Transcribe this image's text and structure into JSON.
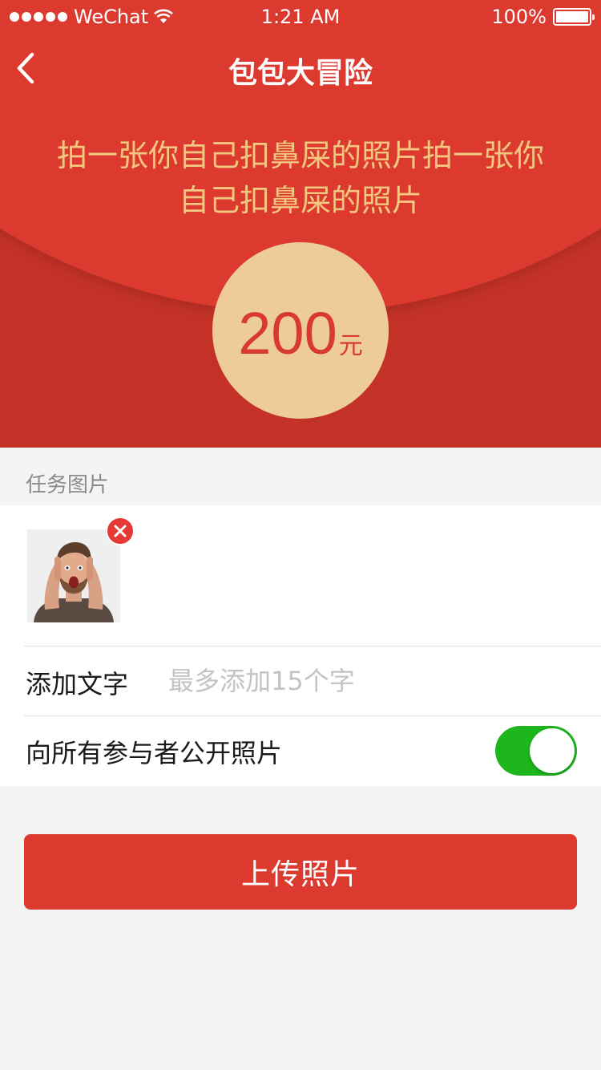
{
  "status_bar": {
    "carrier": "WeChat",
    "time": "1:21 AM",
    "battery": "100%"
  },
  "nav": {
    "title": "包包大冒险"
  },
  "task": {
    "description": "拍一张你自己扣鼻屎的照片拍一张你自己扣鼻屎的照片"
  },
  "reward": {
    "amount": "200",
    "unit": "元"
  },
  "section": {
    "task_image_label": "任务图片"
  },
  "add_text": {
    "label": "添加文字",
    "placeholder": "最多添加15个字",
    "value": ""
  },
  "public_toggle": {
    "label": "向所有参与者公开照片",
    "on": true
  },
  "upload_button": {
    "label": "上传照片"
  },
  "colors": {
    "brand_red": "#dc3a2f",
    "gold_text": "#f3c77f",
    "coin": "#eecc9a",
    "toggle_on": "#1db61d"
  }
}
